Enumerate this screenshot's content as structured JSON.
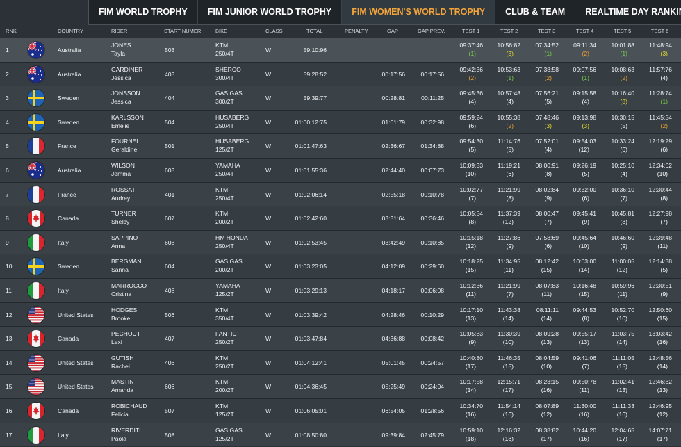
{
  "tabs": [
    {
      "label": "FIM WORLD TROPHY",
      "active": false
    },
    {
      "label": "FIM JUNIOR WORLD TROPHY",
      "active": false
    },
    {
      "label": "FIM WOMEN'S WORLD TROPHY",
      "active": true
    },
    {
      "label": "CLUB & TEAM",
      "active": false
    },
    {
      "label": "REALTIME DAY RANKING",
      "active": false
    }
  ],
  "columns": {
    "rnk": "RNK",
    "country": "COUNTRY",
    "rider": "RIDER",
    "start": "START NUMER",
    "bike": "BIKE",
    "class": "CLASS",
    "total": "TOTAL",
    "penalty": "PENALTY",
    "gap": "GAP",
    "gap_prev": "GAP PREV.",
    "tests": [
      "TEST 1",
      "TEST 2",
      "TEST 3",
      "TEST 4",
      "TEST 5",
      "TEST 6"
    ]
  },
  "rank_colors": {
    "1": "#7ad14a",
    "2": "#e5dc2c",
    "3": "#f0a12f"
  },
  "rows": [
    {
      "rnk": "1",
      "flag": "australia",
      "country": "Australia",
      "surname": "JONES",
      "first": "Tayla",
      "start": "503",
      "bike1": "KTM",
      "bike2": "250/4T",
      "class": "W",
      "total": "59:10:96",
      "penalty": "",
      "gap": "",
      "gap_prev": "",
      "tests": [
        [
          "09:37:46",
          "(1)"
        ],
        [
          "10:56:82",
          "(3)"
        ],
        [
          "07:34:52",
          "(1)"
        ],
        [
          "09:11:34",
          "(2)"
        ],
        [
          "10:01:88",
          "(1)"
        ],
        [
          "11:48:94",
          "(3)"
        ]
      ]
    },
    {
      "rnk": "2",
      "flag": "australia",
      "country": "Australia",
      "surname": "GARDINER",
      "first": "Jessica",
      "start": "403",
      "bike1": "SHERCO",
      "bike2": "300/4T",
      "class": "W",
      "total": "59:28:52",
      "penalty": "",
      "gap": "00:17:56",
      "gap_prev": "00:17:56",
      "tests": [
        [
          "09:42:36",
          "(2)"
        ],
        [
          "10:53:63",
          "(1)"
        ],
        [
          "07:38:58",
          "(2)"
        ],
        [
          "09:07:56",
          "(1)"
        ],
        [
          "10:08:63",
          "(2)"
        ],
        [
          "11:57:76",
          "(4)"
        ]
      ]
    },
    {
      "rnk": "3",
      "flag": "sweden",
      "country": "Sweden",
      "surname": "JONSSON",
      "first": "Jessica",
      "start": "404",
      "bike1": "GAS GAS",
      "bike2": "300/2T",
      "class": "W",
      "total": "59:39:77",
      "penalty": "",
      "gap": "00:28:81",
      "gap_prev": "00:11:25",
      "tests": [
        [
          "09:45:36",
          "(4)"
        ],
        [
          "10:57:48",
          "(4)"
        ],
        [
          "07:56:21",
          "(5)"
        ],
        [
          "09:15:58",
          "(4)"
        ],
        [
          "10:16:40",
          "(3)"
        ],
        [
          "11:28:74",
          "(1)"
        ]
      ]
    },
    {
      "rnk": "4",
      "flag": "sweden",
      "country": "Sweden",
      "surname": "KARLSSON",
      "first": "Emelie",
      "start": "504",
      "bike1": "HUSABERG",
      "bike2": "250/4T",
      "class": "W",
      "total": "01:00:12:75",
      "penalty": "",
      "gap": "01:01:79",
      "gap_prev": "00:32:98",
      "tests": [
        [
          "09:59:24",
          "(6)"
        ],
        [
          "10:55:38",
          "(2)"
        ],
        [
          "07:48:46",
          "(3)"
        ],
        [
          "09:13:98",
          "(3)"
        ],
        [
          "10:30:15",
          "(5)"
        ],
        [
          "11:45:54",
          "(2)"
        ]
      ]
    },
    {
      "rnk": "5",
      "flag": "france",
      "country": "France",
      "surname": "FOURNEL",
      "first": "Geraldine",
      "start": "501",
      "bike1": "HUSABERG",
      "bike2": "125/2T",
      "class": "W",
      "total": "01:01:47:63",
      "penalty": "",
      "gap": "02:36:67",
      "gap_prev": "01:34:88",
      "tests": [
        [
          "09:54:30",
          "(5)"
        ],
        [
          "11:14:76",
          "(5)"
        ],
        [
          "07:52:01",
          "(4)"
        ],
        [
          "09:54:03",
          "(12)"
        ],
        [
          "10:33:24",
          "(6)"
        ],
        [
          "12:19:29",
          "(6)"
        ]
      ]
    },
    {
      "rnk": "6",
      "flag": "australia",
      "country": "Australia",
      "surname": "WILSON",
      "first": "Jemma",
      "start": "603",
      "bike1": "YAMAHA",
      "bike2": "250/4T",
      "class": "W",
      "total": "01:01:55:36",
      "penalty": "",
      "gap": "02:44:40",
      "gap_prev": "00:07:73",
      "tests": [
        [
          "10:09:33",
          "(10)"
        ],
        [
          "11:19:21",
          "(6)"
        ],
        [
          "08:00:91",
          "(8)"
        ],
        [
          "09:26:19",
          "(5)"
        ],
        [
          "10:25:10",
          "(4)"
        ],
        [
          "12:34:62",
          "(10)"
        ]
      ]
    },
    {
      "rnk": "7",
      "flag": "france",
      "country": "France",
      "surname": "ROSSAT",
      "first": "Audrey",
      "start": "401",
      "bike1": "KTM",
      "bike2": "250/4T",
      "class": "W",
      "total": "01:02:06:14",
      "penalty": "",
      "gap": "02:55:18",
      "gap_prev": "00:10:78",
      "tests": [
        [
          "10:02:77",
          "(7)"
        ],
        [
          "11:21:99",
          "(8)"
        ],
        [
          "08:02:84",
          "(9)"
        ],
        [
          "09:32:00",
          "(6)"
        ],
        [
          "10:36:10",
          "(7)"
        ],
        [
          "12:30:44",
          "(8)"
        ]
      ]
    },
    {
      "rnk": "8",
      "flag": "canada",
      "country": "Canada",
      "surname": "TURNER",
      "first": "Shelby",
      "start": "607",
      "bike1": "KTM",
      "bike2": "200/2T",
      "class": "W",
      "total": "01:02:42:60",
      "penalty": "",
      "gap": "03:31:64",
      "gap_prev": "00:36:46",
      "tests": [
        [
          "10:05:54",
          "(8)"
        ],
        [
          "11:37:39",
          "(12)"
        ],
        [
          "08:00:47",
          "(7)"
        ],
        [
          "09:45:41",
          "(9)"
        ],
        [
          "10:45:81",
          "(8)"
        ],
        [
          "12:27:98",
          "(7)"
        ]
      ]
    },
    {
      "rnk": "9",
      "flag": "italy",
      "country": "Italy",
      "surname": "SAPPINO",
      "first": "Anna",
      "start": "608",
      "bike1": "HM HONDA",
      "bike2": "250/4T",
      "class": "W",
      "total": "01:02:53:45",
      "penalty": "",
      "gap": "03:42:49",
      "gap_prev": "00:10:85",
      "tests": [
        [
          "10:15:18",
          "(12)"
        ],
        [
          "11:27:86",
          "(9)"
        ],
        [
          "07:58:69",
          "(6)"
        ],
        [
          "09:45:64",
          "(10)"
        ],
        [
          "10:46:60",
          "(9)"
        ],
        [
          "12:39:48",
          "(11)"
        ]
      ]
    },
    {
      "rnk": "10",
      "flag": "sweden",
      "country": "Sweden",
      "surname": "BERGMAN",
      "first": "Sanna",
      "start": "604",
      "bike1": "GAS GAS",
      "bike2": "200/2T",
      "class": "W",
      "total": "01:03:23:05",
      "penalty": "",
      "gap": "04:12:09",
      "gap_prev": "00:29:60",
      "tests": [
        [
          "10:18:25",
          "(15)"
        ],
        [
          "11:34:95",
          "(11)"
        ],
        [
          "08:12:42",
          "(15)"
        ],
        [
          "10:03:00",
          "(14)"
        ],
        [
          "11:00:05",
          "(12)"
        ],
        [
          "12:14:38",
          "(5)"
        ]
      ]
    },
    {
      "rnk": "11",
      "flag": "italy",
      "country": "Italy",
      "surname": "MARROCCO",
      "first": "Cristina",
      "start": "408",
      "bike1": "YAMAHA",
      "bike2": "125/2T",
      "class": "W",
      "total": "01:03:29:13",
      "penalty": "",
      "gap": "04:18:17",
      "gap_prev": "00:06:08",
      "tests": [
        [
          "10:12:36",
          "(11)"
        ],
        [
          "11:21:99",
          "(7)"
        ],
        [
          "08:07:83",
          "(11)"
        ],
        [
          "10:16:48",
          "(15)"
        ],
        [
          "10:59:96",
          "(11)"
        ],
        [
          "12:30:51",
          "(9)"
        ]
      ]
    },
    {
      "rnk": "12",
      "flag": "usa",
      "country": "United States",
      "surname": "HODGES",
      "first": "Brooke",
      "start": "506",
      "bike1": "KTM",
      "bike2": "350/4T",
      "class": "W",
      "total": "01:03:39:42",
      "penalty": "",
      "gap": "04:28:46",
      "gap_prev": "00:10:29",
      "tests": [
        [
          "10:17:10",
          "(13)"
        ],
        [
          "11:43:38",
          "(14)"
        ],
        [
          "08:11:11",
          "(14)"
        ],
        [
          "09:44:53",
          "(8)"
        ],
        [
          "10:52:70",
          "(10)"
        ],
        [
          "12:50:60",
          "(15)"
        ]
      ]
    },
    {
      "rnk": "13",
      "flag": "canada",
      "country": "Canada",
      "surname": "PECHOUT",
      "first": "Lexi",
      "start": "407",
      "bike1": "FANTIC",
      "bike2": "250/2T",
      "class": "W",
      "total": "01:03:47:84",
      "penalty": "",
      "gap": "04:36:88",
      "gap_prev": "00:08:42",
      "tests": [
        [
          "10:05:83",
          "(9)"
        ],
        [
          "11:30:39",
          "(10)"
        ],
        [
          "08:09:28",
          "(13)"
        ],
        [
          "09:55:17",
          "(13)"
        ],
        [
          "11:03:75",
          "(14)"
        ],
        [
          "13:03:42",
          "(16)"
        ]
      ]
    },
    {
      "rnk": "14",
      "flag": "usa",
      "country": "United States",
      "surname": "GUTISH",
      "first": "Rachel",
      "start": "406",
      "bike1": "KTM",
      "bike2": "250/2T",
      "class": "W",
      "total": "01:04:12:41",
      "penalty": "",
      "gap": "05:01:45",
      "gap_prev": "00:24:57",
      "tests": [
        [
          "10:40:80",
          "(17)"
        ],
        [
          "11:46:35",
          "(15)"
        ],
        [
          "08:04:59",
          "(10)"
        ],
        [
          "09:41:06",
          "(7)"
        ],
        [
          "11:11:05",
          "(15)"
        ],
        [
          "12:48:56",
          "(14)"
        ]
      ]
    },
    {
      "rnk": "15",
      "flag": "usa",
      "country": "United States",
      "surname": "MASTIN",
      "first": "Amanda",
      "start": "606",
      "bike1": "KTM",
      "bike2": "200/2T",
      "class": "W",
      "total": "01:04:36:45",
      "penalty": "",
      "gap": "05:25:49",
      "gap_prev": "00:24:04",
      "tests": [
        [
          "10:17:58",
          "(14)"
        ],
        [
          "12:15:71",
          "(17)"
        ],
        [
          "08:23:15",
          "(16)"
        ],
        [
          "09:50:78",
          "(11)"
        ],
        [
          "11:02:41",
          "(13)"
        ],
        [
          "12:46:82",
          "(13)"
        ]
      ]
    },
    {
      "rnk": "16",
      "flag": "canada",
      "country": "Canada",
      "surname": "ROBICHAUD",
      "first": "Felicia",
      "start": "507",
      "bike1": "KTM",
      "bike2": "125/2T",
      "class": "W",
      "total": "01:06:05:01",
      "penalty": "",
      "gap": "06:54:05",
      "gap_prev": "01:28:56",
      "tests": [
        [
          "10:34:70",
          "(16)"
        ],
        [
          "11:54:14",
          "(16)"
        ],
        [
          "08:07:89",
          "(12)"
        ],
        [
          "11:30:00",
          "(16)"
        ],
        [
          "11:11:33",
          "(16)"
        ],
        [
          "12:46:95",
          "(12)"
        ]
      ]
    },
    {
      "rnk": "17",
      "flag": "italy",
      "country": "Italy",
      "surname": "RIVERDITI",
      "first": "Paola",
      "start": "508",
      "bike1": "GAS GAS",
      "bike2": "125/2T",
      "class": "W",
      "total": "01:08:50:80",
      "penalty": "",
      "gap": "09:39:84",
      "gap_prev": "02:45:79",
      "tests": [
        [
          "10:59:10",
          "(18)"
        ],
        [
          "12:16:32",
          "(18)"
        ],
        [
          "08:38:82",
          "(17)"
        ],
        [
          "10:44:20",
          "(16)"
        ],
        [
          "12:04:65",
          "(17)"
        ],
        [
          "14:07:71",
          "(17)"
        ]
      ]
    }
  ]
}
